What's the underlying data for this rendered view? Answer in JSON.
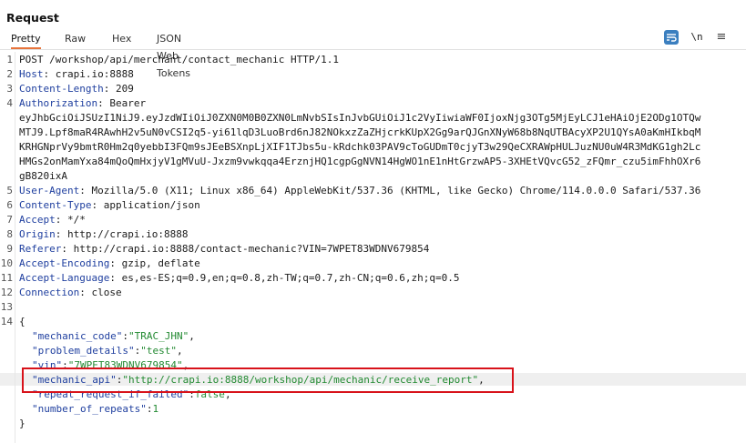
{
  "panel_title": "Request",
  "tabs": [
    "Pretty",
    "Raw",
    "Hex",
    "JSON Web Tokens"
  ],
  "toolbar": {
    "newline_label": "\\n",
    "menu_label": "≡",
    "wrap_icon": "wrap-lines-icon"
  },
  "line_numbers": [
    "1",
    "2",
    "3",
    "4",
    "",
    "",
    "",
    "",
    "5",
    "6",
    "7",
    "8",
    "9",
    "10",
    "11",
    "12",
    "13",
    "14"
  ],
  "request_line": "POST /workshop/api/merchant/contact_mechanic HTTP/1.1",
  "headers": {
    "host": {
      "name": "Host",
      "value": "crapi.io:8888"
    },
    "content_length": {
      "name": "Content-Length",
      "value": "209"
    },
    "authorization": {
      "name": "Authorization",
      "value": "Bearer",
      "token_lines": [
        "eyJhbGciOiJSUzI1NiJ9.eyJzdWIiOiJ0ZXN0M0B0ZXN0LmNvbSIsInJvbGUiOiJ1c2VyIiwiaWF0IjoxNjg3OTg5MjEyLCJ1eHAiOjE2ODg1OTQw",
        "MTJ9.Lpf8maR4RAwhH2v5uN0vCSI2q5-yi61lqD3LuoBrd6nJ82NOkxzZaZHjcrkKUpX2Gg9arQJGnXNyW68b8NqUTBAcyXP2U1QYsA0aKmHIkbqM",
        "KRHGNprVy9bmtR0Hm2q0yebbI3FQm9sJEeBSXnpLjXIF1TJbs5u-kRdchk03PAV9cToGUDmT0cjyT3w29QeCXRAWpHULJuzNU0uW4R3MdKG1gh2Lc",
        "HMGs2onMamYxa84mQoQmHxjyV1gMVuU-Jxzm9vwkqqa4ErznjHQ1cgpGgNVN14HgWO1nE1nHtGrzwAP5-3XHEtVQvcG52_zFQmr_czu5imFhhOXr6",
        "gB820ixA"
      ]
    },
    "user_agent": {
      "name": "User-Agent",
      "value": "Mozilla/5.0 (X11; Linux x86_64) AppleWebKit/537.36 (KHTML, like Gecko) Chrome/114.0.0.0 Safari/537.36"
    },
    "content_type": {
      "name": "Content-Type",
      "value": "application/json"
    },
    "accept": {
      "name": "Accept",
      "value": "*/*"
    },
    "origin": {
      "name": "Origin",
      "value": "http://crapi.io:8888"
    },
    "referer": {
      "name": "Referer",
      "value": "http://crapi.io:8888/contact-mechanic?VIN=7WPET83WDNV679854"
    },
    "accept_encoding": {
      "name": "Accept-Encoding",
      "value": "gzip, deflate"
    },
    "accept_language": {
      "name": "Accept-Language",
      "value": "es,es-ES;q=0.9,en;q=0.8,zh-TW;q=0.7,zh-CN;q=0.6,zh;q=0.5"
    },
    "connection": {
      "name": "Connection",
      "value": "close"
    }
  },
  "body": {
    "open_brace": "{",
    "close_brace": "}",
    "fields": {
      "mechanic_code": {
        "key": "\"mechanic_code\"",
        "value": "\"TRAC_JHN\""
      },
      "problem_details": {
        "key": "\"problem_details\"",
        "value": "\"test\""
      },
      "vin": {
        "key": "\"vin\"",
        "value": "\"7WPET83WDNV679854\""
      },
      "mechanic_api": {
        "key": "\"mechanic_api\"",
        "value": "\"http://crapi.io:8888/workshop/api/mechanic/receive_report\""
      },
      "repeat_request_if_failed": {
        "key": "\"repeat_request_if_failed\"",
        "value": "false"
      },
      "number_of_repeats": {
        "key": "\"number_of_repeats\"",
        "value": "1"
      }
    }
  },
  "colors": {
    "accent_tab": "#e8743b",
    "header_name": "#1f3f9f",
    "json_value": "#238a32",
    "highlight_box": "#d8121a"
  }
}
